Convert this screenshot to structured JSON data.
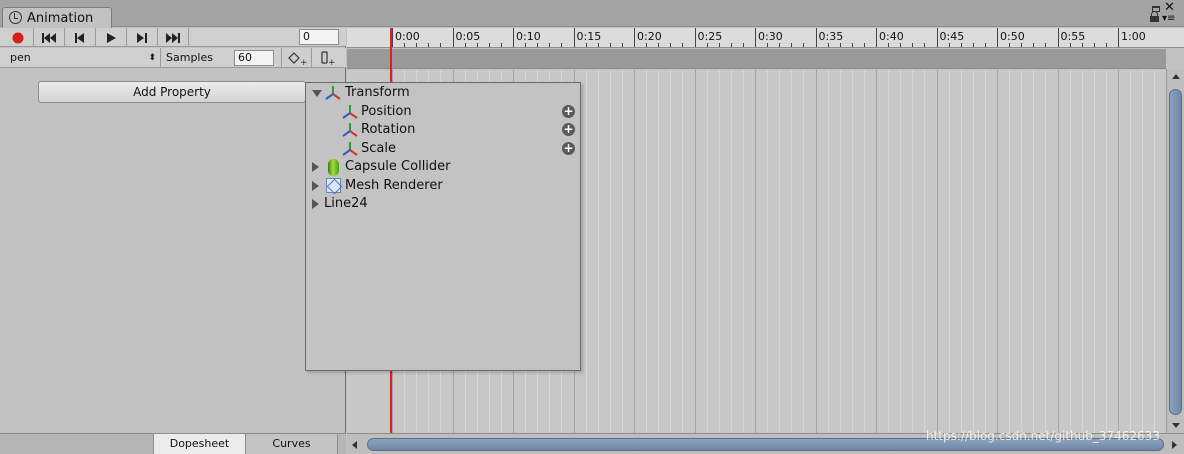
{
  "window": {
    "tab_title": "Animation",
    "tab_icon": "clock-icon",
    "controls": [
      "maximize-icon",
      "close-icon",
      "lock-icon",
      "menu-icon"
    ]
  },
  "toolbar": {
    "buttons": [
      "record-icon",
      "first-key-icon",
      "prev-key-icon",
      "play-icon",
      "next-key-icon",
      "last-key-icon"
    ],
    "frame_value": "0",
    "record_color": "#d81b1b"
  },
  "clip_bar": {
    "clip_name": "pen",
    "samples_label": "Samples",
    "samples_value": "60",
    "add_keyframe_icon": "add-keyframe-icon",
    "add_event_icon": "add-event-icon"
  },
  "add_property_label": "Add Property",
  "property_menu": {
    "items": [
      {
        "label": "Transform",
        "expanded": true,
        "icon": "transform-icon"
      },
      {
        "label": "Position",
        "icon": "transform-icon",
        "addable": true
      },
      {
        "label": "Rotation",
        "icon": "transform-icon",
        "addable": true
      },
      {
        "label": "Scale",
        "icon": "transform-icon",
        "addable": true
      },
      {
        "label": "Capsule Collider",
        "expanded": false,
        "icon": "capsule-icon"
      },
      {
        "label": "Mesh Renderer",
        "expanded": false,
        "icon": "mesh-renderer-icon"
      },
      {
        "label": "Line24",
        "expanded": false
      }
    ]
  },
  "view_tabs": {
    "dopesheet": "Dopesheet",
    "curves": "Curves",
    "active": "Dopesheet"
  },
  "timeline": {
    "ticks": [
      "0:00",
      "0:05",
      "0:10",
      "0:15",
      "0:20",
      "0:25",
      "0:30",
      "0:35",
      "0:40",
      "0:45",
      "0:50",
      "0:55",
      "1:00"
    ],
    "playhead_time": "0:00",
    "playhead_color": "#e02020"
  },
  "watermark": "https://blog.csdn.net/github_37462633"
}
